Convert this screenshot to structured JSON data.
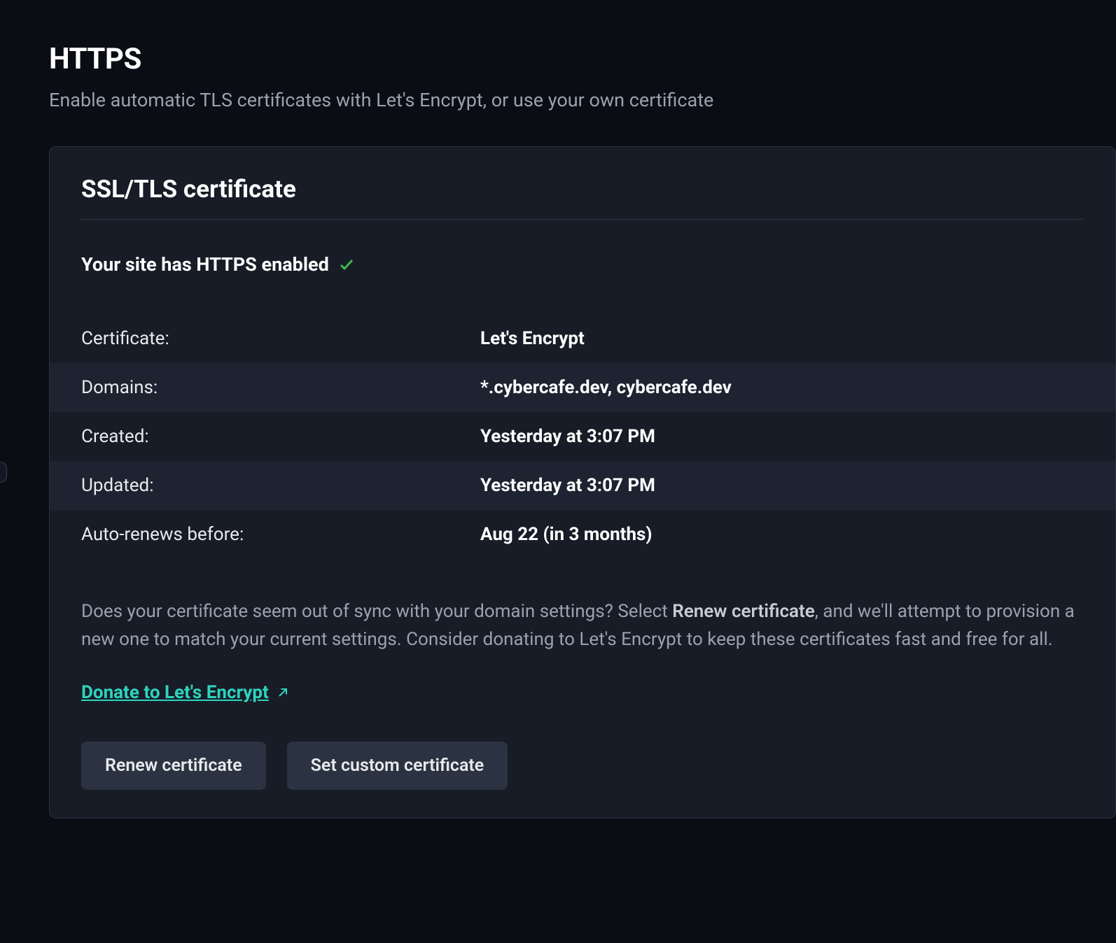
{
  "header": {
    "title": "HTTPS",
    "subtitle": "Enable automatic TLS certificates with Let's Encrypt, or use your own certificate"
  },
  "card": {
    "title": "SSL/TLS certificate",
    "status_text": "Your site has HTTPS enabled",
    "rows": [
      {
        "label": "Certificate:",
        "value": "Let's Encrypt"
      },
      {
        "label": "Domains:",
        "value": "*.cybercafe.dev, cybercafe.dev"
      },
      {
        "label": "Created:",
        "value": "Yesterday at 3:07 PM"
      },
      {
        "label": "Updated:",
        "value": "Yesterday at 3:07 PM"
      },
      {
        "label": "Auto-renews before:",
        "value": "Aug 22 (in 3 months)"
      }
    ],
    "help_pre": "Does your certificate seem out of sync with your domain settings? Select ",
    "help_strong": "Renew certificate",
    "help_post": ", and we'll attempt to provision a new one to match your current settings. Consider donating to Let's Encrypt to keep these certificates fast and free for all.",
    "donate_label": "Donate to Let's Encrypt",
    "buttons": {
      "renew": "Renew certificate",
      "custom": "Set custom certificate"
    }
  }
}
